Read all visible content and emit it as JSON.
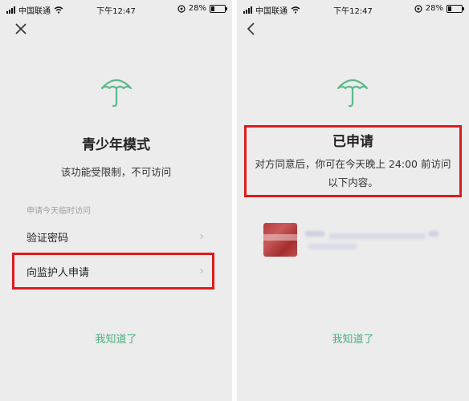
{
  "status_bar": {
    "carrier": "中国联通",
    "time": "下午12:47",
    "battery": "28%"
  },
  "left": {
    "title": "青少年模式",
    "subtitle": "该功能受限制，不可访问",
    "section_label": "申请今天临时访问",
    "items": [
      {
        "label": "验证密码"
      },
      {
        "label": "向监护人申请"
      }
    ],
    "ack_label": "我知道了"
  },
  "right": {
    "title": "已申请",
    "description": "对方同意后，你可在今天晚上 24:00 前访问以下内容。",
    "ack_label": "我知道了"
  },
  "colors": {
    "accent": "#4caf7d",
    "highlight": "#e01b1b",
    "background": "#ececec"
  },
  "icons": {
    "close": "close-icon",
    "back": "back-chevron-icon",
    "umbrella": "umbrella-icon",
    "chevron": "chevron-right-icon"
  }
}
